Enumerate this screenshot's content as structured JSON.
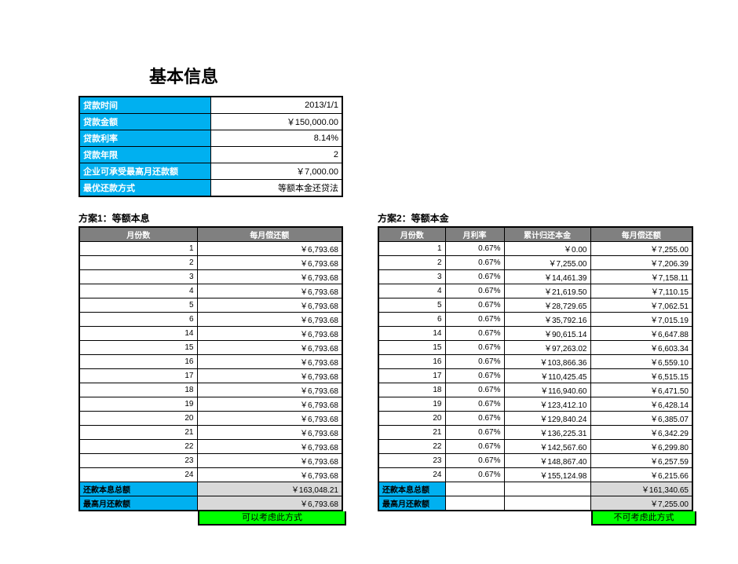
{
  "title": "基本信息",
  "info": [
    {
      "label": "贷款时间",
      "value": "2013/1/1"
    },
    {
      "label": "贷款金额",
      "value": "￥150,000.00"
    },
    {
      "label": "贷款利率",
      "value": "8.14%"
    },
    {
      "label": "贷款年限",
      "value": "2"
    },
    {
      "label": "企业可承受最高月还款额",
      "value": "￥7,000.00"
    },
    {
      "label": "最优还款方式",
      "value": "等额本金还贷法"
    }
  ],
  "plan1": {
    "title": "方案1：等额本息",
    "headers": [
      "月份数",
      "每月偿还额"
    ],
    "rows": [
      {
        "m": "1",
        "pay": "￥6,793.68"
      },
      {
        "m": "2",
        "pay": "￥6,793.68"
      },
      {
        "m": "3",
        "pay": "￥6,793.68"
      },
      {
        "m": "4",
        "pay": "￥6,793.68"
      },
      {
        "m": "5",
        "pay": "￥6,793.68"
      },
      {
        "m": "6",
        "pay": "￥6,793.68"
      },
      {
        "m": "14",
        "pay": "￥6,793.68"
      },
      {
        "m": "15",
        "pay": "￥6,793.68"
      },
      {
        "m": "16",
        "pay": "￥6,793.68"
      },
      {
        "m": "17",
        "pay": "￥6,793.68"
      },
      {
        "m": "18",
        "pay": "￥6,793.68"
      },
      {
        "m": "19",
        "pay": "￥6,793.68"
      },
      {
        "m": "20",
        "pay": "￥6,793.68"
      },
      {
        "m": "21",
        "pay": "￥6,793.68"
      },
      {
        "m": "22",
        "pay": "￥6,793.68"
      },
      {
        "m": "23",
        "pay": "￥6,793.68"
      },
      {
        "m": "24",
        "pay": "￥6,793.68"
      }
    ],
    "sum": [
      {
        "label": "还款本息总额",
        "value": "￥163,048.21"
      },
      {
        "label": "最高月还款额",
        "value": "￥6,793.68"
      }
    ],
    "verdict": "可以考虑此方式"
  },
  "plan2": {
    "title": "方案2：等额本金",
    "headers": [
      "月份数",
      "月利率",
      "累计归还本金",
      "每月偿还额"
    ],
    "rows": [
      {
        "m": "1",
        "r": "0.67%",
        "cum": "￥0.00",
        "pay": "￥7,255.00"
      },
      {
        "m": "2",
        "r": "0.67%",
        "cum": "￥7,255.00",
        "pay": "￥7,206.39"
      },
      {
        "m": "3",
        "r": "0.67%",
        "cum": "￥14,461.39",
        "pay": "￥7,158.11"
      },
      {
        "m": "4",
        "r": "0.67%",
        "cum": "￥21,619.50",
        "pay": "￥7,110.15"
      },
      {
        "m": "5",
        "r": "0.67%",
        "cum": "￥28,729.65",
        "pay": "￥7,062.51"
      },
      {
        "m": "6",
        "r": "0.67%",
        "cum": "￥35,792.16",
        "pay": "￥7,015.19"
      },
      {
        "m": "14",
        "r": "0.67%",
        "cum": "￥90,615.14",
        "pay": "￥6,647.88"
      },
      {
        "m": "15",
        "r": "0.67%",
        "cum": "￥97,263.02",
        "pay": "￥6,603.34"
      },
      {
        "m": "16",
        "r": "0.67%",
        "cum": "￥103,866.36",
        "pay": "￥6,559.10"
      },
      {
        "m": "17",
        "r": "0.67%",
        "cum": "￥110,425.45",
        "pay": "￥6,515.15"
      },
      {
        "m": "18",
        "r": "0.67%",
        "cum": "￥116,940.60",
        "pay": "￥6,471.50"
      },
      {
        "m": "19",
        "r": "0.67%",
        "cum": "￥123,412.10",
        "pay": "￥6,428.14"
      },
      {
        "m": "20",
        "r": "0.67%",
        "cum": "￥129,840.24",
        "pay": "￥6,385.07"
      },
      {
        "m": "21",
        "r": "0.67%",
        "cum": "￥136,225.31",
        "pay": "￥6,342.29"
      },
      {
        "m": "22",
        "r": "0.67%",
        "cum": "￥142,567.60",
        "pay": "￥6,299.80"
      },
      {
        "m": "23",
        "r": "0.67%",
        "cum": "￥148,867.40",
        "pay": "￥6,257.59"
      },
      {
        "m": "24",
        "r": "0.67%",
        "cum": "￥155,124.98",
        "pay": "￥6,215.66"
      }
    ],
    "sum": [
      {
        "label": "还款本息总额",
        "value": "￥161,340.65"
      },
      {
        "label": "最高月还款额",
        "value": "￥7,255.00"
      }
    ],
    "verdict": "不可考虑此方式"
  }
}
